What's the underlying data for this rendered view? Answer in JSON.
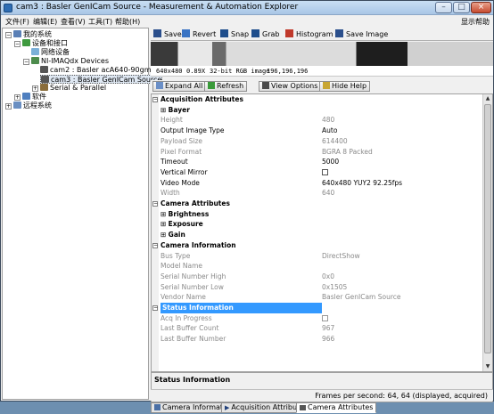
{
  "window": {
    "title": "cam3 : Basler GenICam Source - Measurement & Automation Explorer",
    "buttons": {
      "minimize": "–",
      "maximize": "□",
      "close": "×"
    }
  },
  "menu": [
    "文件(F)",
    "编辑(E)",
    "查看(V)",
    "工具(T)",
    "帮助(H)"
  ],
  "menu_help_right": "显示帮助",
  "tree": [
    {
      "label": "我的系统",
      "icon": "computer-icon"
    },
    {
      "label": "设备和接口",
      "icon": "devices-icon"
    },
    {
      "label": "网络设备",
      "icon": "network-icon"
    },
    {
      "label": "NI-IMAQdx Devices",
      "icon": "camera-folder-icon"
    },
    {
      "label": "cam2 : Basler acA640-90gm",
      "icon": "camera-icon"
    },
    {
      "label": "cam3 : Basler GenICam Source",
      "icon": "camera-icon"
    },
    {
      "label": "Serial & Parallel",
      "icon": "serial-icon"
    },
    {
      "label": "软件",
      "icon": "software-icon"
    },
    {
      "label": "远程系统",
      "icon": "remote-icon"
    }
  ],
  "toolbar": {
    "save": "Save",
    "revert": "Revert",
    "snap": "Snap",
    "grab": "Grab",
    "histogram": "Histogram",
    "save_image": "Save Image"
  },
  "image_info": {
    "resolution": "640x480",
    "zoom": "0.89X",
    "format": "32-bit RGB image",
    "pixel": "196,196,196"
  },
  "grid_toolbar": {
    "expand_all": "Expand All",
    "refresh": "Refresh",
    "view_options": "View Options",
    "hide_help": "Hide Help"
  },
  "rows": [
    {
      "name": "Acquisition Attributes",
      "value": ""
    },
    {
      "name": "Bayer",
      "value": ""
    },
    {
      "name": "Height",
      "value": "480"
    },
    {
      "name": "Output Image Type",
      "value": "Auto"
    },
    {
      "name": "Payload Size",
      "value": "614400"
    },
    {
      "name": "Pixel Format",
      "value": "BGRA 8 Packed"
    },
    {
      "name": "Timeout",
      "value": "5000"
    },
    {
      "name": "Vertical Mirror",
      "value": ""
    },
    {
      "name": "Video Mode",
      "value": "640x480 YUY2 92.25fps"
    },
    {
      "name": "Width",
      "value": "640"
    },
    {
      "name": "Camera Attributes",
      "value": ""
    },
    {
      "name": "Brightness",
      "value": ""
    },
    {
      "name": "Exposure",
      "value": ""
    },
    {
      "name": "Gain",
      "value": ""
    },
    {
      "name": "Camera Information",
      "value": ""
    },
    {
      "name": "Bus Type",
      "value": "DirectShow"
    },
    {
      "name": "Model Name",
      "value": ""
    },
    {
      "name": "Serial Number High",
      "value": "0x0"
    },
    {
      "name": "Serial Number Low",
      "value": "0x1505"
    },
    {
      "name": "Vendor Name",
      "value": "Basler GenICam Source"
    },
    {
      "name": "Status Information",
      "value": ""
    },
    {
      "name": "Acq In Progress",
      "value": ""
    },
    {
      "name": "Last Buffer Count",
      "value": "967"
    },
    {
      "name": "Last Buffer Number",
      "value": "966"
    }
  ],
  "description_title": "Status Information",
  "tabs": [
    "Camera Information",
    "Acquisition Attributes",
    "Camera Attributes"
  ],
  "status": "Frames per second: 64, 64 (displayed, acquired)"
}
